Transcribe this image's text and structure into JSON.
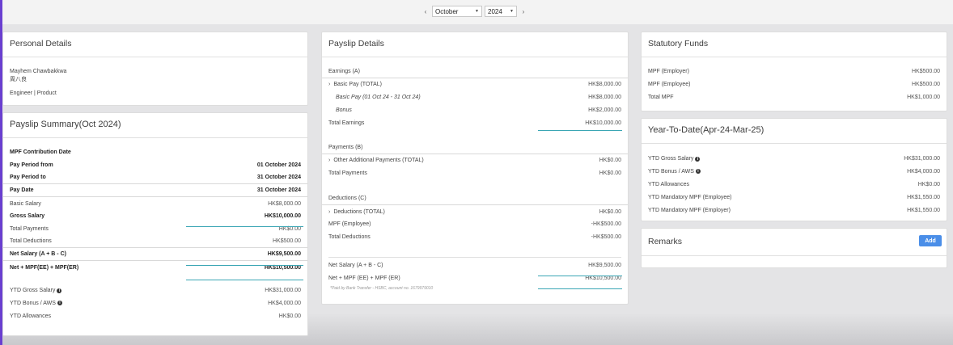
{
  "picker": {
    "prev": "‹",
    "next": "›",
    "month": "October",
    "year": "2024"
  },
  "personal": {
    "title": "Personal Details",
    "name": "Mayhem Chawbakkwa",
    "chinese_name": "周八良",
    "role": "Engineer | Product"
  },
  "summary": {
    "title": "Payslip Summary(Oct 2024)",
    "rows": [
      {
        "label": "MPF Contribution Date",
        "value": ""
      },
      {
        "label": "Pay Period from",
        "value": "01 October 2024"
      },
      {
        "label": "Pay Period to",
        "value": "31 October 2024"
      },
      {
        "label": "Pay Date",
        "value": "31 October 2024"
      },
      {
        "label": "Basic Salary",
        "value": "HK$8,000.00"
      },
      {
        "label": "Gross Salary",
        "value": "HK$10,000.00"
      },
      {
        "label": "Total Payments",
        "value": "HK$0.00"
      },
      {
        "label": "Total Deductions",
        "value": "HK$500.00"
      },
      {
        "label": "Net Salary (A + B - C)",
        "value": "HK$9,500.00"
      },
      {
        "label": "Net + MPF(EE) + MPF(ER)",
        "value": "HK$10,500.00"
      }
    ],
    "ytd": [
      {
        "label": "YTD Gross Salary",
        "value": "HK$31,000.00"
      },
      {
        "label": "YTD Bonus / AWS",
        "value": "HK$4,000.00"
      },
      {
        "label": "YTD Allowances",
        "value": "HK$0.00"
      }
    ]
  },
  "payslip": {
    "title": "Payslip Details",
    "earnings_label": "Earnings (A)",
    "basic_total": {
      "label": "Basic Pay (TOTAL)",
      "value": "HK$8,000.00"
    },
    "basic_period": {
      "label": "Basic Pay (01 Oct 24 - 31 Oct 24)",
      "value": "HK$8,000.00"
    },
    "bonus": {
      "label": "Bonus",
      "value": "HK$2,000.00"
    },
    "total_earnings": {
      "label": "Total Earnings",
      "value": "HK$10,000.00"
    },
    "payments_label": "Payments (B)",
    "other_payments": {
      "label": "Other Additional Payments (TOTAL)",
      "value": "HK$0.00"
    },
    "total_payments": {
      "label": "Total Payments",
      "value": "HK$0.00"
    },
    "deductions_label": "Deductions (C)",
    "deductions_total": {
      "label": "Deductions (TOTAL)",
      "value": "HK$0.00"
    },
    "mpf_employee": {
      "label": "MPF (Employee)",
      "value": "-HK$500.00"
    },
    "total_deductions": {
      "label": "Total Deductions",
      "value": "-HK$500.00"
    },
    "net_salary": {
      "label": "Net Salary (A + B - C)",
      "value": "HK$9,500.00"
    },
    "net_mpf": {
      "label": "Net + MPF (EE) + MPF (ER)",
      "value": "HK$10,500.00"
    },
    "footnote": "*Paid by Bank Transfer - HSBC, account no. 1679979010"
  },
  "statutory": {
    "title": "Statutory Funds",
    "rows": [
      {
        "label": "MPF (Employer)",
        "value": "HK$500.00"
      },
      {
        "label": "MPF (Employee)",
        "value": "HK$500.00"
      },
      {
        "label": "Total MPF",
        "value": "HK$1,000.00"
      }
    ]
  },
  "ytd": {
    "title": "Year-To-Date(Apr-24-Mar-25)",
    "rows": [
      {
        "label": "YTD Gross Salary",
        "value": "HK$31,000.00"
      },
      {
        "label": "YTD Bonus / AWS",
        "value": "HK$4,000.00"
      },
      {
        "label": "YTD Allowances",
        "value": "HK$0.00"
      },
      {
        "label": "YTD Mandatory MPF (Employee)",
        "value": "HK$1,550.00"
      },
      {
        "label": "YTD Mandatory MPF (Employer)",
        "value": "HK$1,550.00"
      }
    ]
  },
  "remarks": {
    "title": "Remarks",
    "add_label": "Add"
  },
  "icons": {
    "info": "info-icon",
    "expand": "chevron-right-icon"
  },
  "colors": {
    "accent": "#6a3fd0",
    "teal": "#3aa6b4",
    "button": "#4a8ee8"
  }
}
